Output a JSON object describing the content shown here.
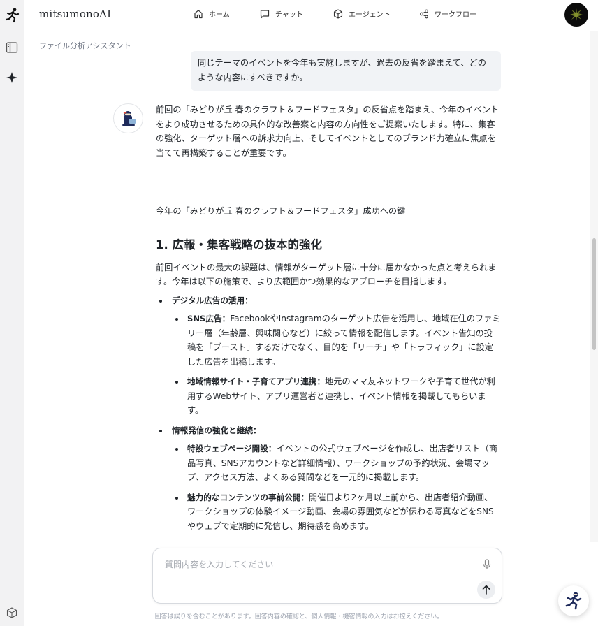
{
  "app": {
    "brand": "mitsumonoAI",
    "page_subtitle": "ファイル分析アシスタント"
  },
  "nav": [
    {
      "label": "ホーム",
      "icon": "home-icon"
    },
    {
      "label": "チャット",
      "icon": "chat-icon"
    },
    {
      "label": "エージェント",
      "icon": "cube-icon"
    },
    {
      "label": "ワークフロー",
      "icon": "share-icon"
    }
  ],
  "chat": {
    "user_message": "同じテーマのイベントを今年も実施しますが、過去の反省を踏まえて、どのような内容にすべきですか。",
    "bot_intro": "前回の「みどりが丘 春のクラフト＆フードフェスタ」の反省点を踏まえ、今年のイベントをより成功させるための具体的な改善案と内容の方向性をご提案いたします。特に、集客の強化、ターゲット層への訴求力向上、そしてイベントとしてのブランド力確立に焦点を当てて再構築することが重要です。",
    "subtitle": "今年の「みどりが丘 春のクラフト＆フードフェスタ」成功への鍵",
    "section1": {
      "heading": "1. 広報・集客戦略の抜本的強化",
      "intro": "前回イベントの最大の課題は、情報がターゲット層に十分に届かなかった点と考えられます。今年は以下の施策で、より広範囲かつ効果的なアプローチを目指します。",
      "groups": [
        {
          "title": "デジタル広告の活用：",
          "items": [
            {
              "label": "SNS広告：",
              "text": "FacebookやInstagramのターゲット広告を活用し、地域在住のファミリー層（年齢層、興味関心など）に絞って情報を配信します。イベント告知の投稿を「ブースト」するだけでなく、目的を「リーチ」や「トラフィック」に設定した広告を出稿します。"
            },
            {
              "label": "地域情報サイト・子育てアプリ連携：",
              "text": "地元のママ友ネットワークや子育て世代が利用するWebサイト、アプリ運営者と連携し、イベント情報を掲載してもらいます。"
            }
          ]
        },
        {
          "title": "情報発信の強化と継続：",
          "items": [
            {
              "label": "特設ウェブページ開設：",
              "text": "イベントの公式ウェブページを作成し、出店者リスト（商品写真、SNSアカウントなど詳細情報）、ワークショップの予約状況、会場マップ、アクセス方法、よくある質問などを一元的に掲載します。"
            },
            {
              "label": "魅力的なコンテンツの事前公開：",
              "text": "開催日より2ヶ月以上前から、出店者紹介動画、ワークショップの体験イメージ動画、会場の雰囲気などが伝わる写真などをSNSやウェブで定期的に発信し、期待感を高めます。"
            }
          ]
        }
      ]
    }
  },
  "input": {
    "placeholder": "質問内容を入力してください",
    "value": ""
  },
  "disclaimer": "回答は誤りを含むことがあります。回答内容の確認と、個人情報・機密情報の入力はお控えください。",
  "colors": {
    "bubble": "#f1f3f6",
    "rail": "#f2f2f3",
    "accent_navy": "#1e2a5a"
  }
}
